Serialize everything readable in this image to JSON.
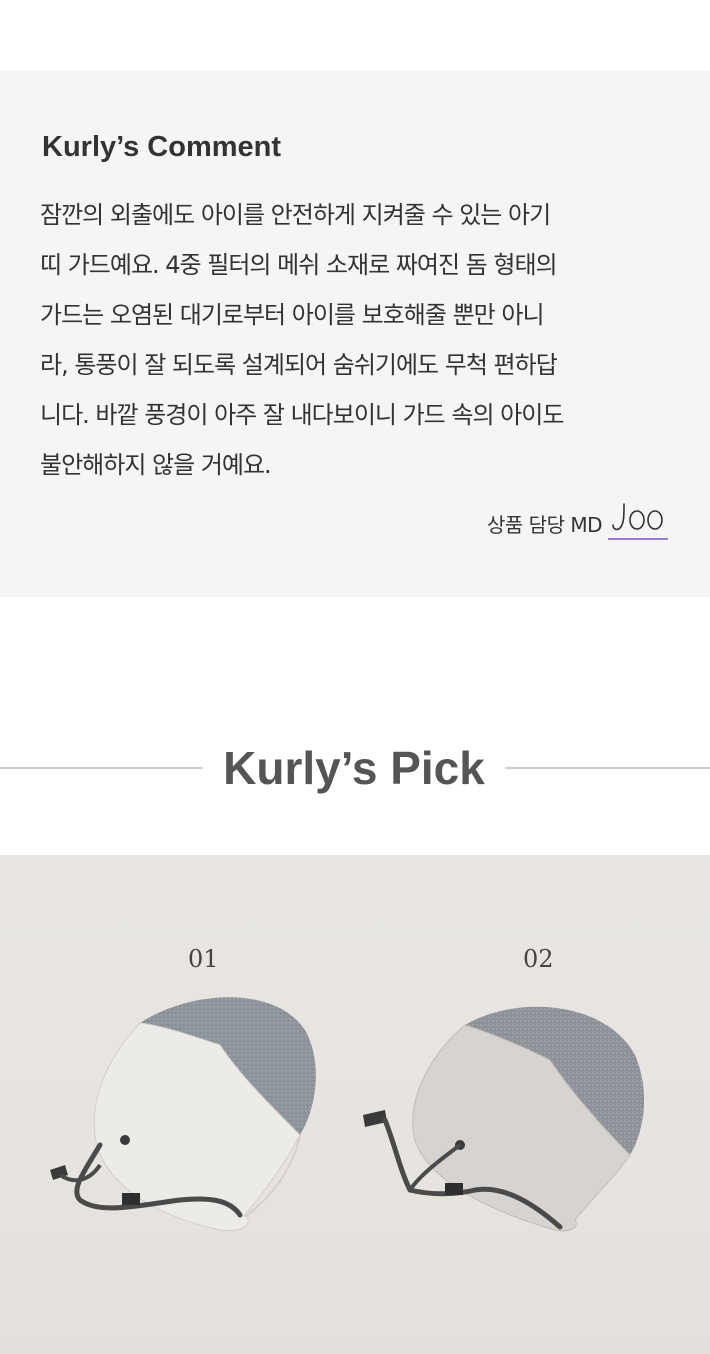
{
  "comment": {
    "title": "Kurly’s Comment",
    "body": "잠깐의 외출에도 아이를 안전하게 지켜줄 수 있는 아기\n띠 가드예요. 4중 필터의 메쉬 소재로 짜여진 돔 형태의\n가드는 오염된 대기로부터 아이를 보호해줄 뿐만 아니\n라, 통풍이 잘 되도록 설계되어 숨쉬기에도 무척 편하답\n니다. 바깥 풍경이 아주 잘 내다보이니 가드 속의 아이도\n불안해하지 않을 거예요.",
    "md_label": "상품 담당 MD",
    "md_signature": "Joo"
  },
  "pick": {
    "title": "Kurly’s Pick"
  },
  "photo": {
    "labels": [
      "01",
      "02"
    ]
  },
  "colors": {
    "comment_bg": "#f5f5f5",
    "signature_underline": "#9b7cd1",
    "photo_bg": "#e8e5e0"
  }
}
